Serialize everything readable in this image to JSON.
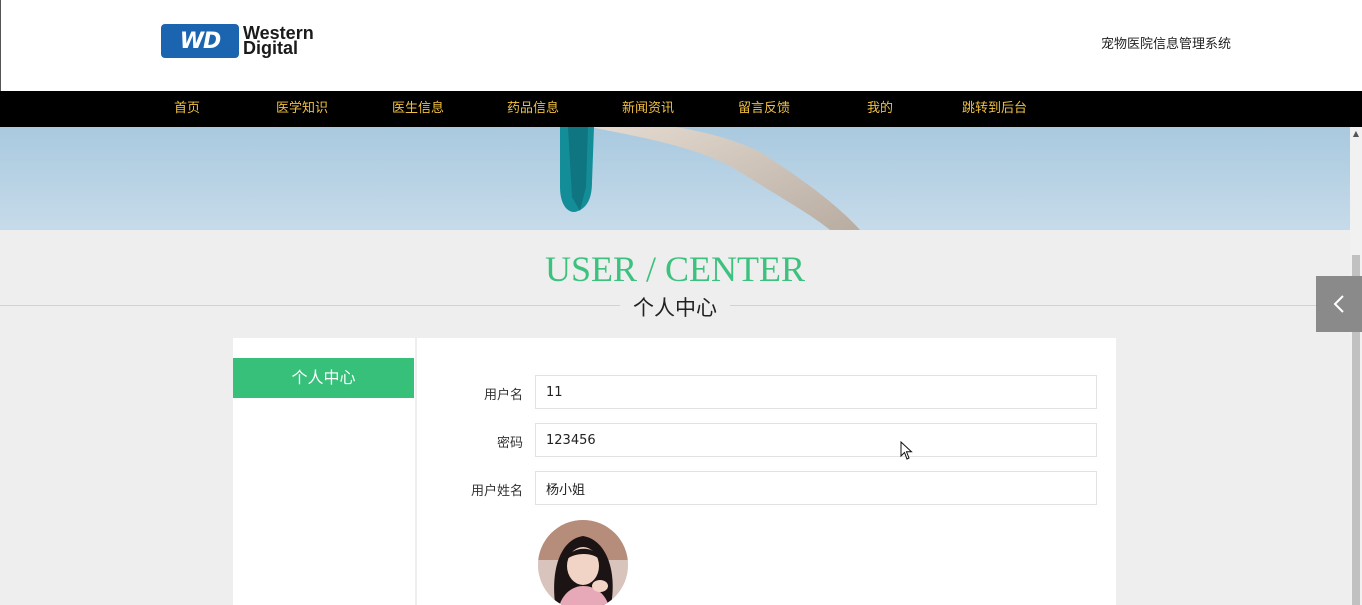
{
  "header": {
    "logo_mark": "WD",
    "logo_line1": "Western",
    "logo_line2": "Digital",
    "site_title": "宠物医院信息管理系统"
  },
  "nav": {
    "items": [
      {
        "label": "首页"
      },
      {
        "label": "医学知识"
      },
      {
        "label": "医生信息"
      },
      {
        "label": "药品信息"
      },
      {
        "label": "新闻资讯"
      },
      {
        "label": "留言反馈"
      },
      {
        "label": "我的"
      },
      {
        "label": "跳转到后台"
      }
    ]
  },
  "section": {
    "title_en": "USER / CENTER",
    "title_cn": "个人中心"
  },
  "sidebar": {
    "active_item": "个人中心"
  },
  "form": {
    "fields": [
      {
        "label": "用户名",
        "value": "11"
      },
      {
        "label": "密码",
        "value": "123456"
      },
      {
        "label": "用户姓名",
        "value": "杨小姐"
      }
    ]
  },
  "icons": {
    "side_toggle": "chevron-left-icon",
    "scroll_up": "arrow-up-icon",
    "cursor": "mouse-pointer-icon"
  },
  "colors": {
    "accent": "#36c07a",
    "nav_text": "#f0c040",
    "nav_bg": "#000000"
  }
}
